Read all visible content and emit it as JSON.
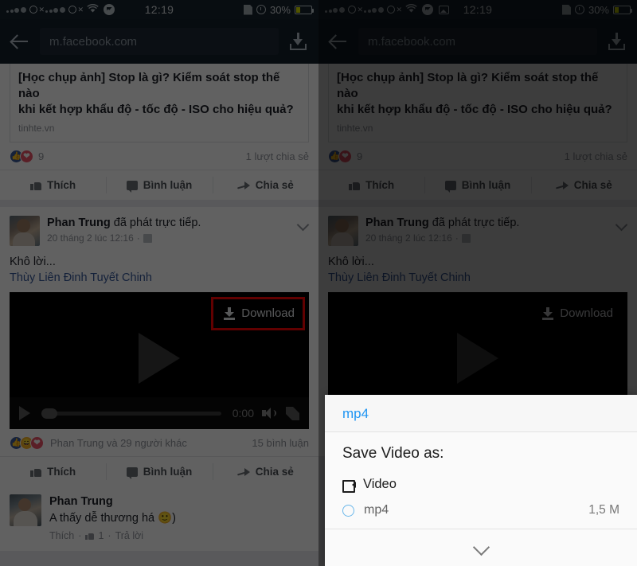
{
  "status_bar": {
    "time": "12:19",
    "battery_percent": "30%",
    "icons_left": [
      "signal-dots-sim1",
      "sim1-no-service",
      "signal-dots-sim2",
      "sim2-no-service",
      "wifi-icon",
      "messenger-icon"
    ],
    "icons_left_right_panel": [
      "signal-dots-sim1",
      "sim1-no-service",
      "signal-dots-sim2",
      "sim2-no-service",
      "wifi-icon",
      "messenger-icon",
      "gallery-icon"
    ],
    "icons_right": [
      "sim-card-icon",
      "alarm-clock-icon",
      "battery-icon"
    ]
  },
  "browser": {
    "url": "m.facebook.com",
    "back_icon": "back-arrow-icon",
    "download_icon": "download-icon"
  },
  "link_card": {
    "title_line1": "[Học chụp ảnh] Stop là gì? Kiểm soát stop thế nào",
    "title_line2": "khi kết hợp khẩu độ - tốc độ - ISO cho hiệu quả?",
    "source": "tinhte.vn"
  },
  "post_top": {
    "reaction_count": "9",
    "share_count": "1 lượt chia sẻ",
    "actions": [
      {
        "label": "Thích",
        "icon": "thumbs-up-icon"
      },
      {
        "label": "Bình luận",
        "icon": "comment-icon"
      },
      {
        "label": "Chia sẻ",
        "icon": "share-icon"
      }
    ]
  },
  "post_video": {
    "author": "Phan Trung",
    "action_text": " đã phát trực tiếp.",
    "timestamp": "20 tháng 2 lúc 12:16",
    "privacy_icon": "friends-icon",
    "menu_icon": "chevron-down-icon",
    "body_text": "Khô lời...",
    "tagged_text": "Thùy Liên Đinh Tuyết Chinh",
    "download_button_label": "Download",
    "download_button_icon": "download-icon",
    "play_icon": "play-icon",
    "video_time": "0:00",
    "volume_icon": "volume-icon",
    "fullscreen_icon": "fullscreen-icon",
    "reaction_names": "Phan Trung và 29 người khác",
    "comment_count": "15 bình luận",
    "actions": [
      {
        "label": "Thích",
        "icon": "thumbs-up-icon"
      },
      {
        "label": "Bình luận",
        "icon": "comment-icon"
      },
      {
        "label": "Chia sẻ",
        "icon": "share-icon"
      }
    ]
  },
  "comment": {
    "author": "Phan Trung",
    "text": "A thấy dễ thương há 🙂)",
    "like_label": "Thích",
    "like_count": "1",
    "reply_label": "Trả lời",
    "separator": "·"
  },
  "save_dialog": {
    "header": "mp4",
    "title": "Save Video as:",
    "group_label": "Video",
    "group_icon": "camcorder-icon",
    "option_label": "mp4",
    "option_size": "1,5 M",
    "radio_icon": "radio-unselected-icon",
    "collapse_icon": "chevron-down-icon"
  },
  "colors": {
    "highlight": "#fe0000",
    "link_blue": "#2196f3",
    "fb_blue": "#3b5998",
    "battery": "#d8e000"
  }
}
